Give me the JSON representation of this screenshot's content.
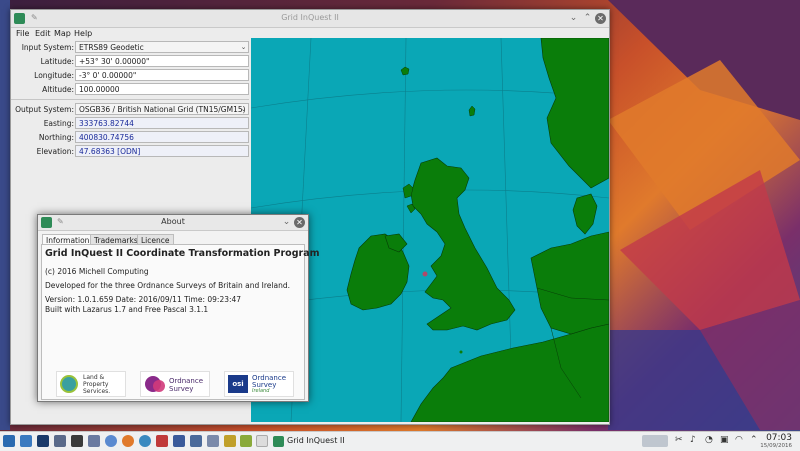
{
  "main_window": {
    "title": "Grid InQuest II",
    "menu": [
      "File",
      "Edit",
      "Map",
      "Help"
    ],
    "input": {
      "system_label": "Input System:",
      "system_value": "ETRS89 Geodetic",
      "latitude_label": "Latitude:",
      "latitude_value": "+53° 30' 0.00000\"",
      "longitude_label": "Longitude:",
      "longitude_value": "-3° 0' 0.00000\"",
      "altitude_label": "Altitude:",
      "altitude_value": "100.00000"
    },
    "output": {
      "system_label": "Output System:",
      "system_value": "OSGB36 / British National Grid (TN15/GM15)",
      "easting_label": "Easting:",
      "easting_value": "333763.82744",
      "northing_label": "Northing:",
      "northing_value": "400830.74756",
      "elevation_label": "Elevation:",
      "elevation_value": "47.68363 [ODN]"
    }
  },
  "about_dialog": {
    "title": "About",
    "tabs": [
      "Information",
      "Trademarks",
      "Licence"
    ],
    "heading": "Grid InQuest II Coordinate Transformation Program",
    "copyright": "(c) 2016 Michell Computing",
    "developed_for": "Developed for the three Ordnance Surveys of Britain and Ireland.",
    "version_line": "Version: 1.0.1.659  Date: 2016/09/11  Time: 09:23:47",
    "built_line": "Built with Lazarus 1.7 and Free Pascal 3.1.1",
    "logos": {
      "lps_line1": "Land &",
      "lps_line2": "Property",
      "lps_line3": "Services.",
      "osgb_line1": "Ordnance",
      "osgb_line2": "Survey",
      "osi_line1": "Ordnance",
      "osi_line2": "Survey",
      "osi_line3": "Ireland"
    }
  },
  "taskbar": {
    "task_label": "Grid InQuest II",
    "time": "07:03",
    "date": "15/09/2016"
  },
  "colors": {
    "sea": "#0aa7b6",
    "land": "#0a7d0a",
    "output_text": "#1a2a9a"
  }
}
